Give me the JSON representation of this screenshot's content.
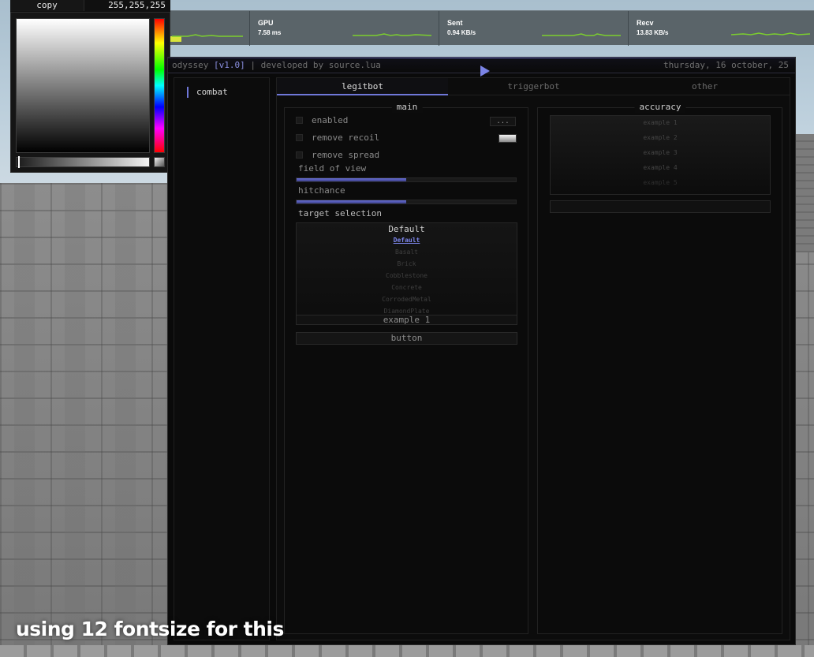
{
  "picker": {
    "copy_label": "copy",
    "rgb_value": "255,255,255"
  },
  "stats": [
    {
      "label": "GPU",
      "value": "7.58 ms"
    },
    {
      "label": "Sent",
      "value": "0.94 KB/s"
    },
    {
      "label": "Recv",
      "value": "13.83 KB/s"
    }
  ],
  "window": {
    "title_name": "odyssey",
    "title_version": "[v1.0]",
    "title_rest": "| developed by source.lua",
    "date": "thursday, 16 october, 25",
    "accent_color": "#6f77d8"
  },
  "sidebar": {
    "items": [
      {
        "label": "combat"
      }
    ]
  },
  "tabs": [
    {
      "label": "legitbot",
      "active": true
    },
    {
      "label": "triggerbot",
      "active": false
    },
    {
      "label": "other",
      "active": false
    }
  ],
  "main_section": {
    "title": "main",
    "enabled_label": "enabled",
    "enabled_button": "...",
    "recoil_label": "remove recoil",
    "spread_label": "remove spread",
    "fov_label": "field of view",
    "fov_fraction": 0.5,
    "hitchance_label": "hitchance",
    "hitchance_fraction": 0.5,
    "target_label": "target selection",
    "material_selected": "Default",
    "materials": [
      "Default",
      "Basalt",
      "Brick",
      "Cobblestone",
      "Concrete",
      "CorrodedMetal",
      "DiamondPlate"
    ],
    "dropdown_value": "example 1",
    "button_label": "button"
  },
  "accuracy_section": {
    "title": "accuracy",
    "items": [
      "example 1",
      "example 2",
      "example 3",
      "example 4",
      "example 5"
    ]
  },
  "caption": "using 12 fontsize for this"
}
